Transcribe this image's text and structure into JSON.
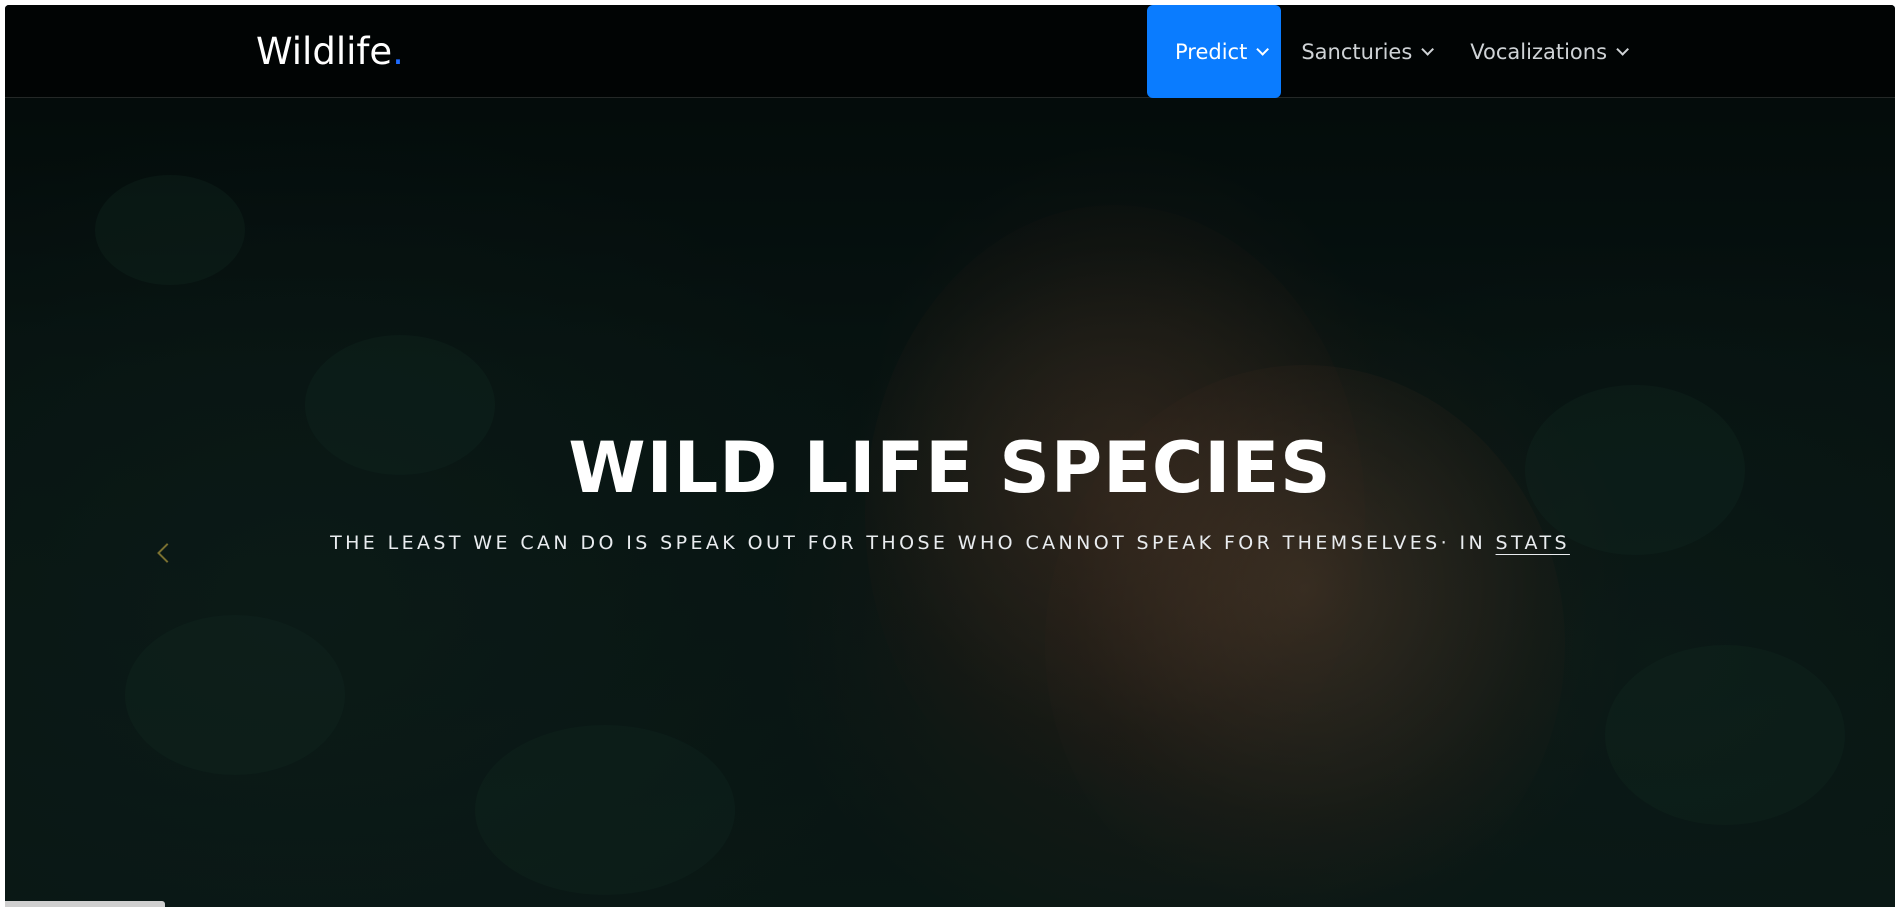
{
  "brand": {
    "name": "Wildlife",
    "dot": "."
  },
  "nav": {
    "items": [
      {
        "label": "Predict",
        "active": true
      },
      {
        "label": "Sancturies",
        "active": false
      },
      {
        "label": "Vocalizations",
        "active": false
      }
    ]
  },
  "hero": {
    "title": "WILD LIFE SPECIES",
    "subtitle": "THE LEAST WE CAN DO IS SPEAK OUT FOR THOSE WHO CANNOT SPEAK FOR THEMSELVES· IN",
    "link": "STATS"
  },
  "colors": {
    "accent": "#0a7cff",
    "brand_dot": "#1e6bff",
    "background": "#081513"
  },
  "icons": {
    "nav_caret": "chevron-down-icon",
    "carousel_prev": "chevron-left-icon"
  }
}
